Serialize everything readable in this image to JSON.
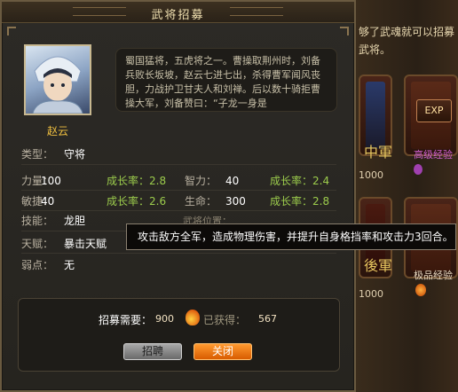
{
  "dialog": {
    "title": "武将招募",
    "hero_name": "赵云",
    "bio": "蜀国猛将，五虎将之一。曹操取荆州时，刘备兵败长坂坡，赵云七进七出，杀得曹军闻风丧胆，力战护卫甘夫人和刘禅。后以数十骑拒曹操大军，刘备赞曰：“子龙一身是"
  },
  "stats": {
    "type_label": "类型：",
    "type_value": "守将",
    "power_label": "力量：",
    "power_value": "100",
    "power_growth": "成长率：2.8",
    "wisdom_label": "智力：",
    "wisdom_value": "40",
    "wisdom_growth": "成长率：2.4",
    "agility_label": "敏捷：",
    "agility_value": "40",
    "agility_growth": "成长率：2.6",
    "life_label": "生命：",
    "life_value": "300",
    "life_growth": "成长率：2.8",
    "skill_label": "技能：",
    "skill_value": "龙胆",
    "talent_label": "天赋：",
    "talent_value": "暴击天赋",
    "weakness_label": "弱点：",
    "weakness_value": "无",
    "skill_position_label": "武将位置："
  },
  "tooltip": {
    "text": "攻击敌方全军，造成物理伤害，并提升自身格挡率和攻击力3回合。"
  },
  "footer": {
    "cost_label": "招募需要：",
    "cost_value": "900",
    "obtained_label": "已获得：",
    "obtained_value": "567",
    "recruit_button": "招聘",
    "close_button": "关闭"
  },
  "background": {
    "text_line1": "够了武魂就可以招募",
    "text_line2": "武将。",
    "card_badge": "EXP",
    "card_label1": "高级经验",
    "card_label2": "极品经验",
    "card_price1": "1000",
    "card_price2": "1000",
    "banner1": "中軍",
    "banner2": "後軍"
  },
  "colors": {
    "growth": "#9ccc4c",
    "hero_name": "#f0c040",
    "close_button": "#ff8a20"
  }
}
